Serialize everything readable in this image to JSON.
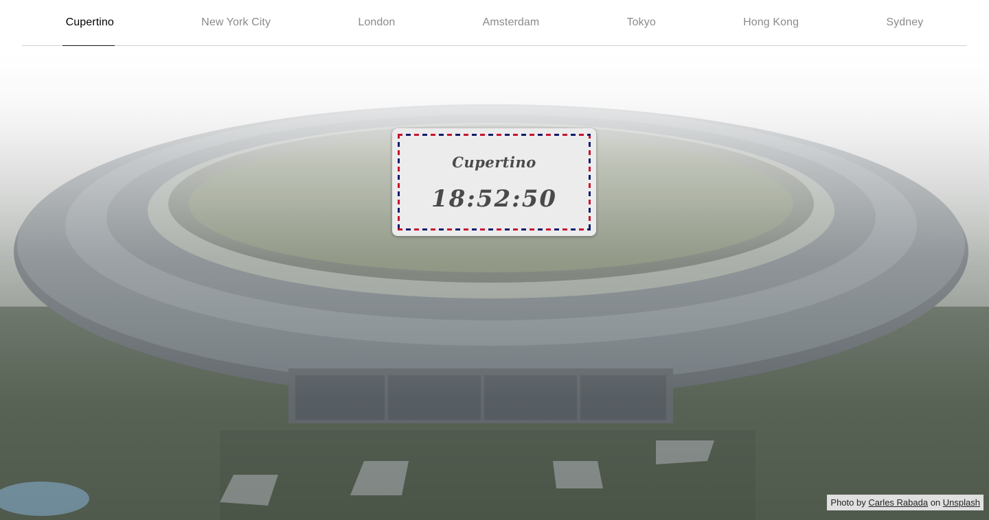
{
  "nav": {
    "active_index": 0,
    "items": [
      {
        "label": "Cupertino"
      },
      {
        "label": "New York City"
      },
      {
        "label": "London"
      },
      {
        "label": "Amsterdam"
      },
      {
        "label": "Tokyo"
      },
      {
        "label": "Hong Kong"
      },
      {
        "label": "Sydney"
      }
    ]
  },
  "clock": {
    "city": "Cupertino",
    "time": "18:52:50"
  },
  "credit": {
    "prefix": "Photo by",
    "author": "Carles Rabada",
    "middle": "on",
    "site": "Unsplash"
  },
  "colors": {
    "active_tab": "#000000",
    "inactive_tab": "#8a8a8a",
    "border_red": "#c8102e",
    "border_blue": "#0f1a6b",
    "card_bg": "#ececec"
  }
}
